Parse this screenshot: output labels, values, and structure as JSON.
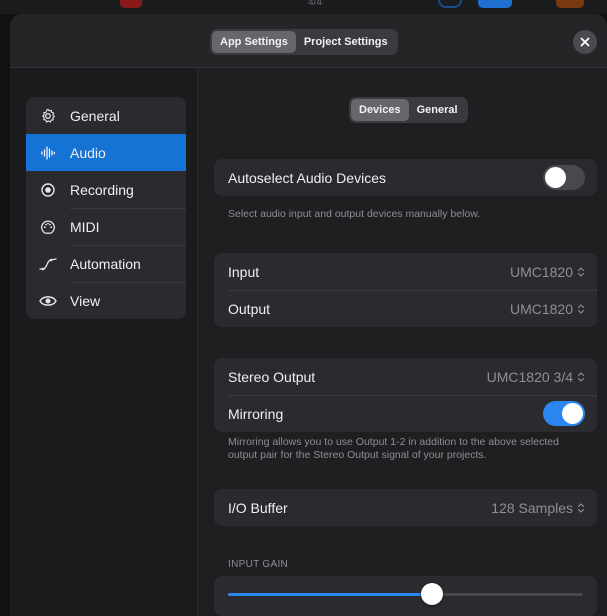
{
  "host": {
    "page_indicator": "4/4"
  },
  "header": {
    "tabs": [
      {
        "label": "App Settings",
        "active": true
      },
      {
        "label": "Project Settings",
        "active": false
      }
    ],
    "close_icon": "close-icon"
  },
  "sidebar": {
    "items": [
      {
        "label": "General",
        "icon": "gear-icon",
        "active": false
      },
      {
        "label": "Audio",
        "icon": "waveform-icon",
        "active": true
      },
      {
        "label": "Recording",
        "icon": "record-icon",
        "active": false
      },
      {
        "label": "MIDI",
        "icon": "midi-port-icon",
        "active": false
      },
      {
        "label": "Automation",
        "icon": "automation-curve-icon",
        "active": false
      },
      {
        "label": "View",
        "icon": "eye-icon",
        "active": false
      }
    ]
  },
  "main": {
    "tabs": [
      {
        "label": "Devices",
        "active": true
      },
      {
        "label": "General",
        "active": false
      }
    ],
    "autoselect": {
      "label": "Autoselect Audio Devices",
      "enabled": false
    },
    "autoselect_note": "Select audio input and output devices manually below.",
    "io": {
      "input_label": "Input",
      "input_value": "UMC1820",
      "output_label": "Output",
      "output_value": "UMC1820"
    },
    "stereo": {
      "label": "Stereo Output",
      "value": "UMC1820 3/4",
      "mirroring_label": "Mirroring",
      "mirroring_enabled": true
    },
    "mirroring_note": "Mirroring allows you to use Output 1-2 in addition to the above selected output pair for the Stereo Output signal of your projects.",
    "buffer": {
      "label": "I/O Buffer",
      "value": "128 Samples"
    },
    "input_gain": {
      "caption": "INPUT GAIN",
      "level": 0.58
    }
  },
  "colors": {
    "accent": "#2b86f0",
    "selection": "#1673d6",
    "background": "#1f1f22",
    "card": "#2b2b2f"
  }
}
